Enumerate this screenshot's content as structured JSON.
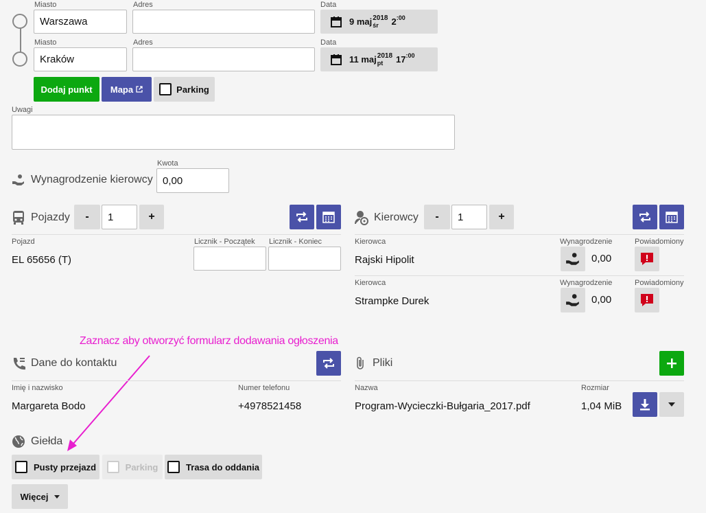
{
  "route": {
    "labels": {
      "city": "Miasto",
      "address": "Adres",
      "date": "Data"
    },
    "points": [
      {
        "city": "Warszawa",
        "address": "",
        "day": "9 maj",
        "year": "2018",
        "weekday": "śr",
        "hour": "2",
        "minutes": ":00"
      },
      {
        "city": "Kraków",
        "address": "",
        "day": "11 maj",
        "year": "2018",
        "weekday": "pt",
        "hour": "17",
        "minutes": ":00"
      }
    ],
    "add_point": "Dodaj punkt",
    "map": "Mapa",
    "parking": "Parking"
  },
  "notes": {
    "label": "Uwagi",
    "value": ""
  },
  "driver_pay": {
    "title": "Wynagrodzenie kierowcy",
    "amount_label": "Kwota",
    "amount": "0,00"
  },
  "vehicles": {
    "title": "Pojazdy",
    "minus": "-",
    "count": "1",
    "plus": "+",
    "col_vehicle": "Pojazd",
    "col_start": "Licznik - Początek",
    "col_end": "Licznik - Koniec",
    "rows": [
      {
        "vehicle": "EL 65656 (T)",
        "start": "",
        "end": ""
      }
    ]
  },
  "drivers": {
    "title": "Kierowcy",
    "minus": "-",
    "count": "1",
    "plus": "+",
    "col_driver": "Kierowca",
    "col_pay": "Wynagrodzenie",
    "col_notified": "Powiadomiony",
    "rows": [
      {
        "name": "Rajski Hipolit",
        "pay": "0,00"
      },
      {
        "name": "Strampke Durek",
        "pay": "0,00"
      }
    ]
  },
  "annotation": "Zaznacz aby otworzyć formularz dodawania ogłoszenia",
  "contact": {
    "title": "Dane do kontaktu",
    "col_name": "Imię i nazwisko",
    "col_phone": "Numer telefonu",
    "name": "Margareta Bodo",
    "phone": "+4978521458"
  },
  "files": {
    "title": "Pliki",
    "col_name": "Nazwa",
    "col_size": "Rozmiar",
    "rows": [
      {
        "name": "Program-Wycieczki-Bułgaria_2017.pdf",
        "size": "1,04 MiB"
      }
    ]
  },
  "exchange": {
    "title": "Giełda",
    "empty_run": "Pusty przejazd",
    "parking": "Parking",
    "return_route": "Trasa do oddania",
    "more": "Więcej"
  },
  "colors": {
    "green": "#0ca810",
    "blue": "#4a52a8",
    "red": "#d0021b",
    "annotation": "#e81fcf"
  }
}
